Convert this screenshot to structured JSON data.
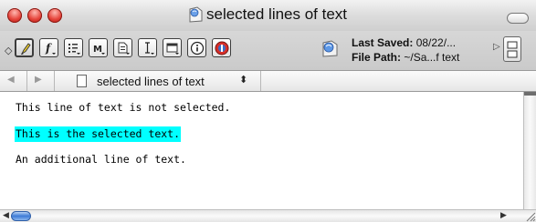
{
  "window": {
    "title": "selected lines of text"
  },
  "toolbar": {
    "info_saved_label": "Last Saved:",
    "info_saved_value": "08/22/...",
    "info_path_label": "File Path:",
    "info_path_value": "~/Sa...f text"
  },
  "navbar": {
    "title": "selected lines of text",
    "popup_glyph": "⬍"
  },
  "document": {
    "lines": [
      "This line of text is not selected.",
      "This is the selected text.",
      "An additional line of text."
    ],
    "selection_color": "#00ffff"
  },
  "colors": {
    "close": "#e5433a",
    "minimize": "#e5433a",
    "zoom": "#e5433a",
    "scroll_thumb": "#3d7bd6"
  }
}
